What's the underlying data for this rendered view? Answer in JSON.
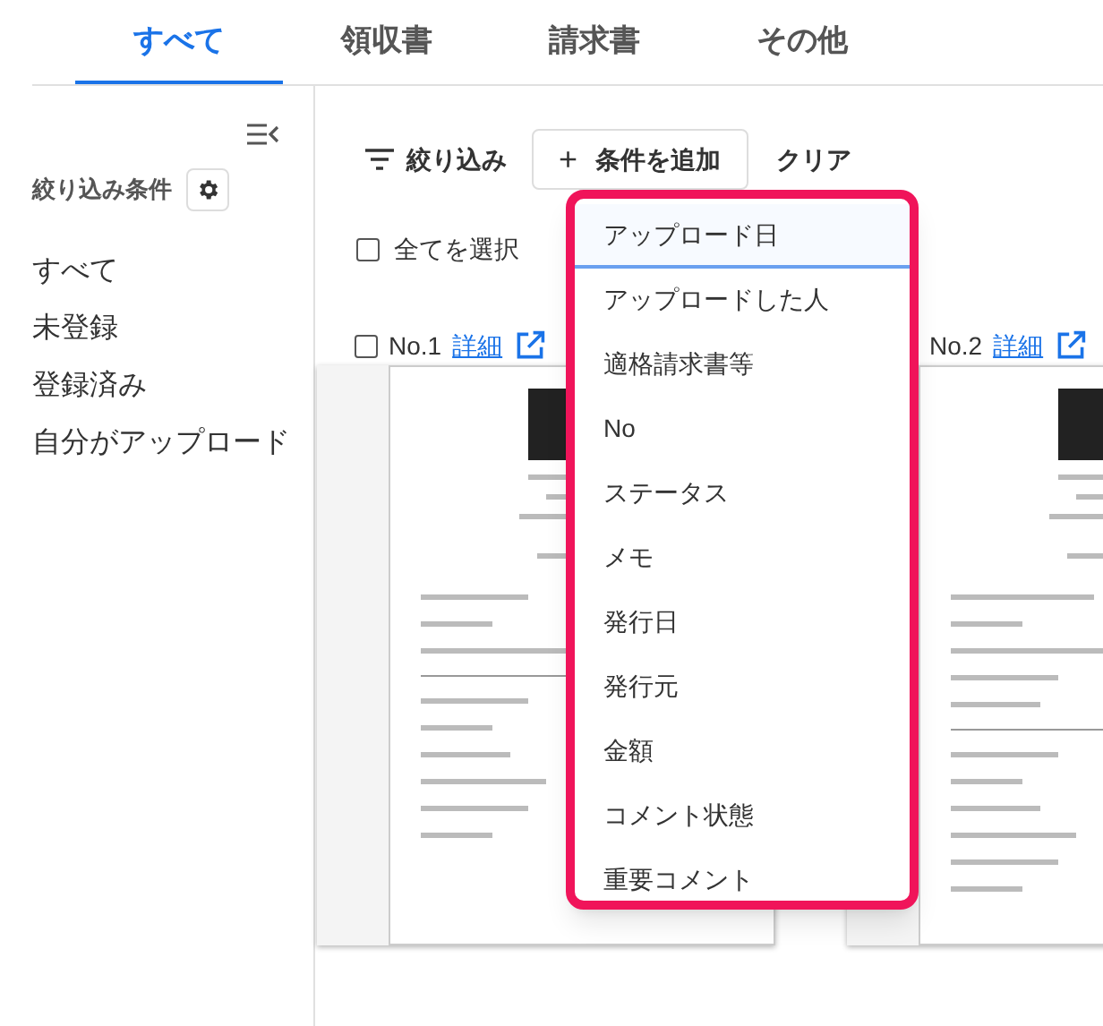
{
  "tabs": [
    {
      "label": "すべて",
      "selected": true
    },
    {
      "label": "領収書",
      "selected": false
    },
    {
      "label": "請求書",
      "selected": false
    },
    {
      "label": "その他",
      "selected": false
    }
  ],
  "sidebar": {
    "title": "絞り込み条件",
    "items": [
      {
        "label": "すべて"
      },
      {
        "label": "未登録"
      },
      {
        "label": "登録済み"
      },
      {
        "label": "自分がアップロード"
      }
    ]
  },
  "toolbar": {
    "filter_label": "絞り込み",
    "add_button": "条件を追加",
    "add_icon": "+",
    "clear_button": "クリア"
  },
  "select_all": {
    "label": "全てを選択",
    "checked": false
  },
  "cards": [
    {
      "number": "No.1",
      "link": "詳細",
      "checked": false
    },
    {
      "number": "No.2",
      "link": "詳細"
    }
  ],
  "dropdown": {
    "items": [
      {
        "label": "アップロード日",
        "selected": true
      },
      {
        "label": "アップロードした人",
        "selected": false
      },
      {
        "label": "適格請求書等",
        "selected": false
      },
      {
        "label": "No",
        "selected": false
      },
      {
        "label": "ステータス",
        "selected": false
      },
      {
        "label": "メモ",
        "selected": false
      },
      {
        "label": "発行日",
        "selected": false
      },
      {
        "label": "発行元",
        "selected": false
      },
      {
        "label": "金額",
        "selected": false
      },
      {
        "label": "コメント状態",
        "selected": false
      },
      {
        "label": "重要コメント",
        "selected": false
      }
    ]
  }
}
